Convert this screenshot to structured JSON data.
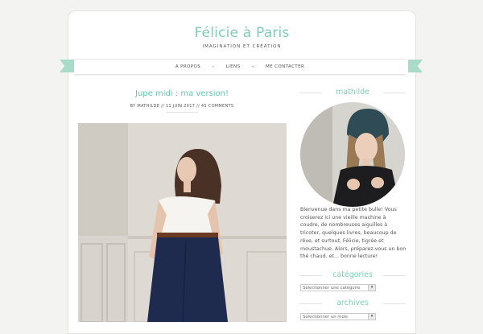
{
  "site": {
    "title": "Félicie à Paris",
    "tagline": "IMAGINATION ET CRÉATION"
  },
  "nav": {
    "items": [
      {
        "label": "A PROPOS"
      },
      {
        "label": "LIENS"
      },
      {
        "label": "ME CONTACTER"
      }
    ],
    "separator": "•"
  },
  "post": {
    "title": "Jupe midi : ma version!",
    "meta": {
      "by": "BY MATHILDE",
      "sep": "//",
      "date": "11 JUIN 2017",
      "comments": "45 COMMENTS"
    }
  },
  "sidebar": {
    "about_heading": "mathilde",
    "bio": "Bienvenue dans ma petite bulle! Vous croiserez ici une vieille machine à coudre, de nombreuses aiguilles à tricoter, quelques livres, beaucoup de rêve, et surtout, Félicie, tigrée et moustachue. Alors, préparez-vous un bon thé chaud, et... bonne lecture!",
    "categories_heading": "catégories",
    "categories_select": "Sélectionner une catégorie",
    "archives_heading": "archives",
    "archives_select": "Sélectionner un mois"
  },
  "colors": {
    "accent": "#7fcdb5",
    "ribbon": "#a8dcc9",
    "background": "#f3f3f1"
  }
}
